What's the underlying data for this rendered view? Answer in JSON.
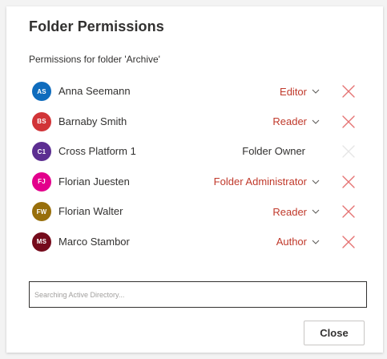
{
  "dialog": {
    "title": "Folder Permissions",
    "subtitle": "Permissions for folder 'Archive'",
    "close_label": "Close"
  },
  "search": {
    "placeholder": "Searching Active Directory..."
  },
  "colors": {
    "role_accent": "#c0392b",
    "remove_icon": "#e57373",
    "remove_icon_disabled": "#e6e6e6"
  },
  "permissions": [
    {
      "initials": "AS",
      "name": "Anna Seemann",
      "role": "Editor",
      "editable": true,
      "avatar_color": "#0f6cbd",
      "remove_icon": "close-icon"
    },
    {
      "initials": "BS",
      "name": "Barnaby Smith",
      "role": "Reader",
      "editable": true,
      "avatar_color": "#d13438",
      "remove_icon": "close-icon"
    },
    {
      "initials": "C1",
      "name": "Cross Platform 1",
      "role": "Folder Owner",
      "editable": false,
      "avatar_color": "#5c2e91",
      "remove_icon": "close-icon"
    },
    {
      "initials": "FJ",
      "name": "Florian Juesten",
      "role": "Folder Administrator",
      "editable": true,
      "avatar_color": "#e3008c",
      "remove_icon": "close-icon"
    },
    {
      "initials": "FW",
      "name": "Florian Walter",
      "role": "Reader",
      "editable": true,
      "avatar_color": "#986f0b",
      "remove_icon": "close-icon"
    },
    {
      "initials": "MS",
      "name": "Marco Stambor",
      "role": "Author",
      "editable": true,
      "avatar_color": "#750b1c",
      "remove_icon": "close-icon"
    }
  ]
}
